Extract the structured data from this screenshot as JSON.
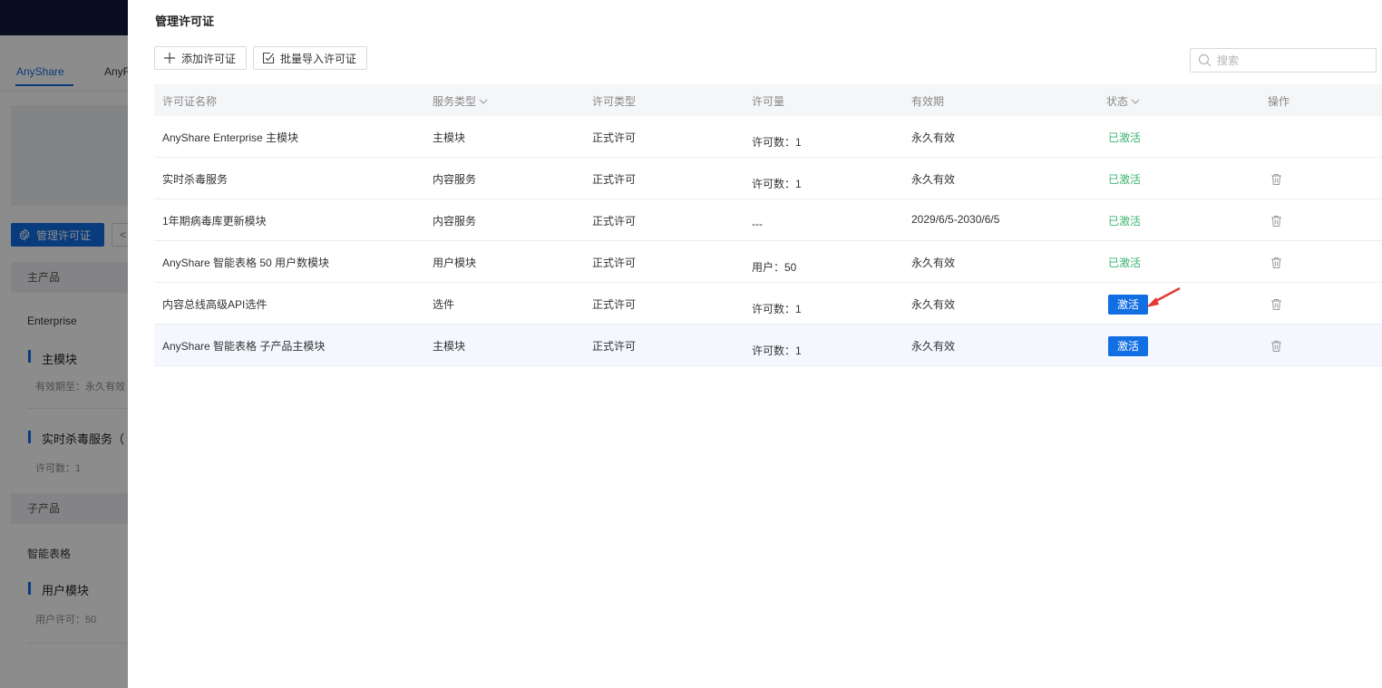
{
  "background": {
    "tabs": [
      "AnyShare",
      "AnyF"
    ],
    "manage_button": "管理许可证",
    "next_button": "<",
    "sections": {
      "main_product": "主产品",
      "enterprise": "Enterprise",
      "main_module": "主模块",
      "main_module_validity": "有效期至：永久有效",
      "antivirus": "实时杀毒服务（",
      "antivirus_count": "许可数：1",
      "sub_product": "子产品",
      "smart_table": "智能表格",
      "user_module": "用户模块",
      "user_module_count": "用户许可：50"
    }
  },
  "drawer": {
    "title": "管理许可证",
    "toolbar": {
      "add_label": "添加许可证",
      "import_label": "批量导入许可证",
      "search_placeholder": "搜索"
    },
    "table": {
      "headers": {
        "name": "许可证名称",
        "service_type": "服务类型",
        "license_type": "许可类型",
        "quantity": "许可量",
        "validity": "有效期",
        "status": "状态",
        "action": "操作"
      },
      "rows": [
        {
          "name": "AnyShare Enterprise 主模块",
          "service_type": "主模块",
          "license_type": "正式许可",
          "quantity": "许可数：1",
          "validity": "永久有效",
          "status": "已激活",
          "status_kind": "activated",
          "deletable": false
        },
        {
          "name": "实时杀毒服务",
          "service_type": "内容服务",
          "license_type": "正式许可",
          "quantity": "许可数：1",
          "validity": "永久有效",
          "status": "已激活",
          "status_kind": "activated",
          "deletable": true
        },
        {
          "name": "1年期病毒库更新模块",
          "service_type": "内容服务",
          "license_type": "正式许可",
          "quantity": "---",
          "validity": "2029/6/5-2030/6/5",
          "status": "已激活",
          "status_kind": "activated",
          "deletable": true
        },
        {
          "name": "AnyShare 智能表格 50 用户数模块",
          "service_type": "用户模块",
          "license_type": "正式许可",
          "quantity": "用户：50",
          "validity": "永久有效",
          "status": "已激活",
          "status_kind": "activated",
          "deletable": true
        },
        {
          "name": "内容总线高级API选件",
          "service_type": "选件",
          "license_type": "正式许可",
          "quantity": "许可数：1",
          "validity": "永久有效",
          "status": "激活",
          "status_kind": "button",
          "deletable": true
        },
        {
          "name": "AnyShare 智能表格 子产品主模块",
          "service_type": "主模块",
          "license_type": "正式许可",
          "quantity": "许可数：1",
          "validity": "永久有效",
          "status": "激活",
          "status_kind": "button",
          "deletable": true,
          "highlighted": true
        }
      ]
    }
  },
  "colors": {
    "accent": "#126ee3",
    "activated": "#3cb371",
    "topbar": "#141b3c",
    "annotation_arrow": "#e53935"
  }
}
